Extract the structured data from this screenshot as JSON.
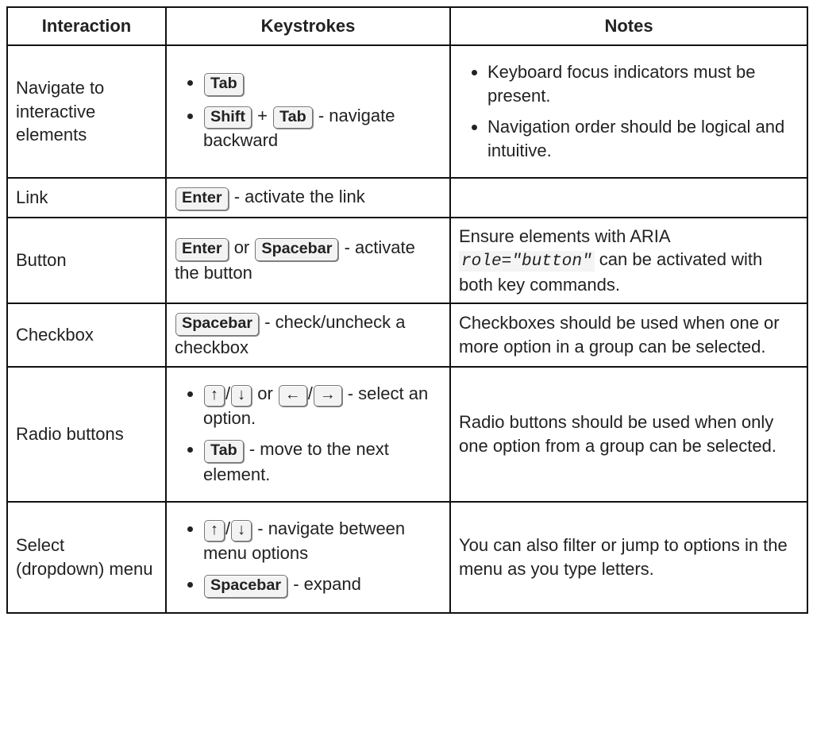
{
  "headers": {
    "interaction": "Interaction",
    "keystrokes": "Keystrokes",
    "notes": "Notes"
  },
  "keys": {
    "tab": "Tab",
    "shift": "Shift",
    "enter": "Enter",
    "spacebar": "Spacebar",
    "up": "↑",
    "down": "↓",
    "left": "←",
    "right": "→"
  },
  "labels": {
    "plus": " + ",
    "slash": "/",
    "or": " or ",
    "dash": " - "
  },
  "rows": {
    "r1": {
      "interaction": "Navigate to interactive elements",
      "key_item2_suffix": "navigate backward",
      "note1": "Keyboard focus indicators must be present.",
      "note2": "Navigation order should be logical and intuitive."
    },
    "r2": {
      "interaction": "Link",
      "key_suffix": "activate the link"
    },
    "r3": {
      "interaction": "Button",
      "key_suffix": "activate the button",
      "note_prefix": "Ensure elements with ARIA ",
      "note_code": "role=\"button\"",
      "note_suffix": " can be activated with both key commands."
    },
    "r4": {
      "interaction": "Checkbox",
      "key_suffix": "check/uncheck a checkbox",
      "note": "Checkboxes should be used when one or more option in a group can be selected."
    },
    "r5": {
      "interaction": "Radio buttons",
      "key_item1_suffix": "select an option.",
      "key_item2_suffix": "move to the next element.",
      "note": "Radio buttons should be used when only one option from a group can be selected."
    },
    "r6": {
      "interaction": "Select (dropdown) menu",
      "key_item1_suffix": "navigate between menu options",
      "key_item2_suffix": "expand",
      "note": "You can also filter or jump to options in the menu as you type letters."
    }
  }
}
